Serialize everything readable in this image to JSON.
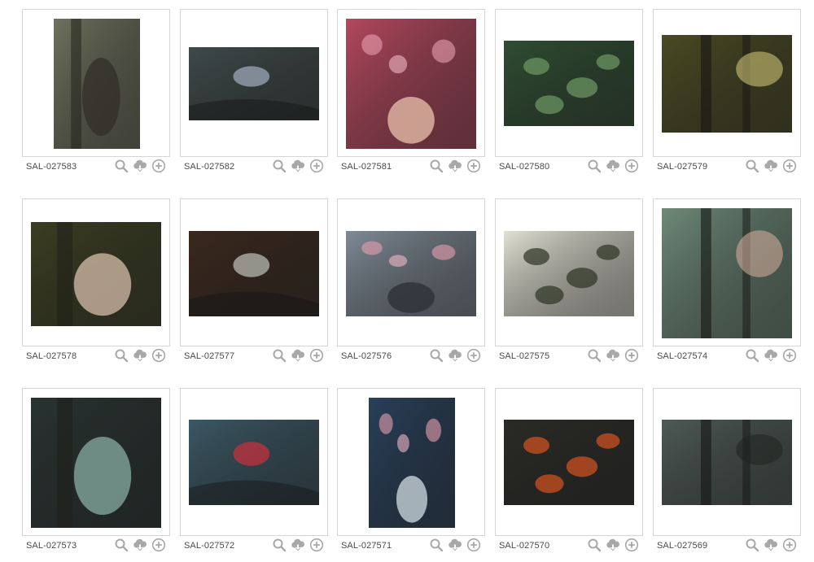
{
  "icons": {
    "preview": "magnifier-icon",
    "download": "cloud-download-icon",
    "add": "plus-circle-icon"
  },
  "colors": {
    "icon_gray": "#a8a8a8",
    "card_border": "#d6d6d6",
    "label_text": "#4a4a4a"
  },
  "items": [
    {
      "id": "SAL-027583",
      "orientation": "portrait",
      "bg": "#6f725e",
      "fg": "#2f2c26"
    },
    {
      "id": "SAL-027582",
      "orientation": "landscape",
      "bg": "#3f4a4a",
      "fg": "#9aa7b7"
    },
    {
      "id": "SAL-027581",
      "orientation": "portrait",
      "bg": "#b5485e",
      "fg": "#e2b9a5"
    },
    {
      "id": "SAL-027580",
      "orientation": "landscape",
      "bg": "#2f4e32",
      "fg": "#6f9a64"
    },
    {
      "id": "SAL-027579",
      "orientation": "landscape",
      "bg": "#4a4a22",
      "fg": "#d9d07a"
    },
    {
      "id": "SAL-027578",
      "orientation": "landscape",
      "bg": "#3b3e21",
      "fg": "#e1c7b2"
    },
    {
      "id": "SAL-027577",
      "orientation": "landscape",
      "bg": "#3a281d",
      "fg": "#b5b8b0"
    },
    {
      "id": "SAL-027576",
      "orientation": "landscape",
      "bg": "#7f8b96",
      "fg": "#2d3138"
    },
    {
      "id": "SAL-027575",
      "orientation": "landscape",
      "bg": "#e2e1d4",
      "fg": "#2c3324"
    },
    {
      "id": "SAL-027574",
      "orientation": "portrait-wide",
      "bg": "#6e8a78",
      "fg": "#d9b1a1"
    },
    {
      "id": "SAL-027573",
      "orientation": "square",
      "bg": "#283331",
      "fg": "#8fb6ab"
    },
    {
      "id": "SAL-027572",
      "orientation": "landscape",
      "bg": "#3b5864",
      "fg": "#c2313c"
    },
    {
      "id": "SAL-027571",
      "orientation": "portrait",
      "bg": "#28405b",
      "fg": "#c7d2d8"
    },
    {
      "id": "SAL-027570",
      "orientation": "landscape",
      "bg": "#2a2a26",
      "fg": "#d6541f"
    },
    {
      "id": "SAL-027569",
      "orientation": "landscape",
      "bg": "#4e5a55",
      "fg": "#1e2420"
    }
  ]
}
